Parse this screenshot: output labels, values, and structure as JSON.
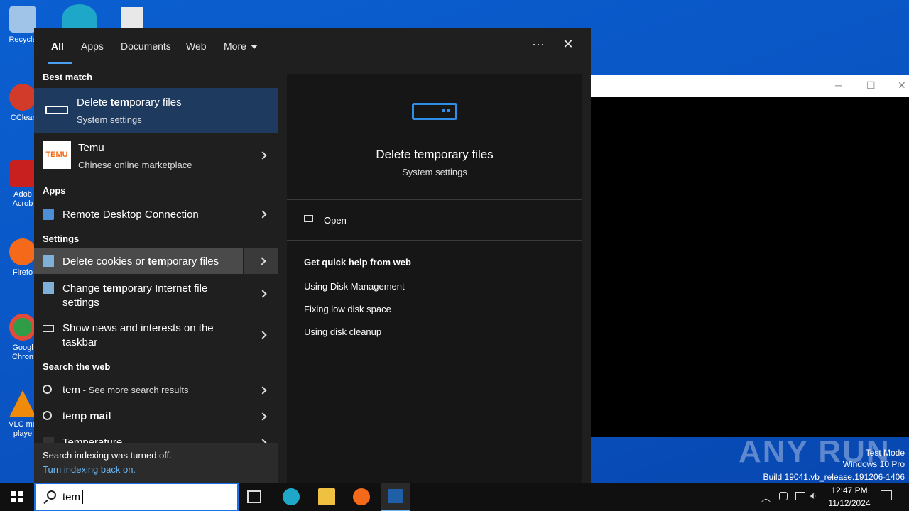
{
  "desktop": {
    "icons": [
      {
        "label": "Recycle",
        "color": "#9fc4e8"
      },
      {
        "label": "CClear",
        "color": "#d23a2a"
      },
      {
        "label": "Adob Acrob",
        "color": "#c8201f"
      },
      {
        "label": "Firefo",
        "color": "#f56a1a"
      },
      {
        "label": "Googl Chron",
        "color": "#2f9c47"
      },
      {
        "label": "VLC me playe",
        "color": "#f08a0a"
      }
    ]
  },
  "watermark": {
    "brand": "ANY RUN",
    "mode": "Test Mode",
    "edition": "Windows 10 Pro",
    "build": "Build 19041.vb_release.191206-1406"
  },
  "tabs": {
    "all": "All",
    "apps": "Apps",
    "documents": "Documents",
    "web": "Web",
    "more": "More",
    "ellipsis": "···",
    "close": "✕"
  },
  "results": {
    "best_match_header": "Best match",
    "best": {
      "pre": "Delete ",
      "bold": "tem",
      "post": "porary files",
      "sub": "System settings"
    },
    "temu": {
      "title": "Temu",
      "sub": "Chinese online marketplace",
      "logo": "TEMU"
    },
    "apps_header": "Apps",
    "rdc": "Remote Desktop Connection",
    "settings_header": "Settings",
    "cookies": {
      "pre": "Delete cookies or ",
      "bold": "tem",
      "post": "porary files"
    },
    "change": {
      "pre": "Change ",
      "bold": "tem",
      "post": "porary Internet file",
      "line2": "settings"
    },
    "news": {
      "line1": "Show news and interests on the",
      "line2": "taskbar"
    },
    "web_header": "Search the web",
    "web1": {
      "bold": "tem",
      "post": " - See more search results"
    },
    "web2": {
      "pre": "tem",
      "bold": "p mail"
    },
    "web3": "Temperature"
  },
  "footer": {
    "notice": "Search indexing was turned off.",
    "link": "Turn indexing back on."
  },
  "detail": {
    "title": "Delete temporary files",
    "subtitle": "System settings",
    "open": "Open",
    "help_header": "Get quick help from web",
    "links": [
      "Using Disk Management",
      "Fixing low disk space",
      "Using disk cleanup"
    ]
  },
  "taskbar": {
    "search_value": "tem",
    "time": "12:47 PM",
    "date": "11/12/2024"
  },
  "colors": {
    "accent": "#4aa0f0",
    "selected": "#1e3a5f",
    "hover": "#4a4a4a"
  }
}
